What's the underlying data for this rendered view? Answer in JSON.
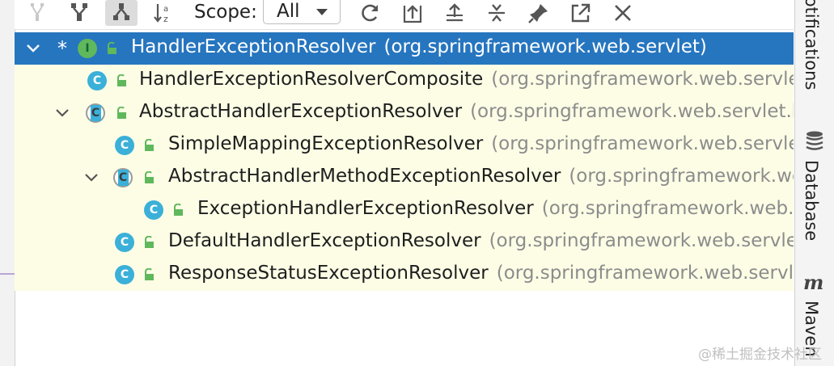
{
  "toolbar": {
    "scope_label": "Scope:",
    "scope_value": "All",
    "buttons": [
      {
        "name": "supertypes-hierarchy-icon",
        "active": false
      },
      {
        "name": "subtypes-hierarchy-icon",
        "active": false
      },
      {
        "name": "class-hierarchy-icon",
        "active": true
      },
      {
        "name": "sort-alphabetically-icon",
        "active": false
      },
      {
        "name": "refresh-icon",
        "active": false
      },
      {
        "name": "export-to-text-icon",
        "active": false
      },
      {
        "name": "expand-all-icon",
        "active": false
      },
      {
        "name": "collapse-all-icon",
        "active": false
      },
      {
        "name": "pin-tab-icon",
        "active": false
      },
      {
        "name": "open-in-window-icon",
        "active": false
      },
      {
        "name": "close-icon",
        "active": false
      }
    ]
  },
  "tree": {
    "rows": [
      {
        "name": "HandlerExceptionResolver",
        "package": "(org.springframework.web.servlet)",
        "kind": "interface",
        "expanded": true,
        "selected": true,
        "focus_marker": "*"
      },
      {
        "name": "HandlerExceptionResolverComposite",
        "package": "(org.springframework.web.servlet.handler)",
        "kind": "class"
      },
      {
        "name": "AbstractHandlerExceptionResolver",
        "package": "(org.springframework.web.servlet.handler)",
        "kind": "abstract-class",
        "expanded": true
      },
      {
        "name": "SimpleMappingExceptionResolver",
        "package": "(org.springframework.web.servlet.handler)",
        "kind": "class"
      },
      {
        "name": "AbstractHandlerMethodExceptionResolver",
        "package": "(org.springframework.web.servlet.handler)",
        "kind": "abstract-class",
        "expanded": true
      },
      {
        "name": "ExceptionHandlerExceptionResolver",
        "package": "(org.springframework.web.servlet.mvc.method.annotation)",
        "kind": "class"
      },
      {
        "name": "DefaultHandlerExceptionResolver",
        "package": "(org.springframework.web.servlet.mvc.support)",
        "kind": "class"
      },
      {
        "name": "ResponseStatusExceptionResolver",
        "package": "(org.springframework.web.servlet.mvc.annotation)",
        "kind": "class"
      }
    ]
  },
  "right_bar": {
    "notifications_label": "Notifications",
    "database_label": "Database",
    "maven_label": "Maven"
  },
  "watermark": "@稀土掘金技术社区",
  "colors": {
    "selection": "#2675bf",
    "tree_background": "#fdfde6",
    "class_icon": "#3bb0d8",
    "interface_icon": "#5fb85c",
    "public_lock": "#5fb85c"
  }
}
